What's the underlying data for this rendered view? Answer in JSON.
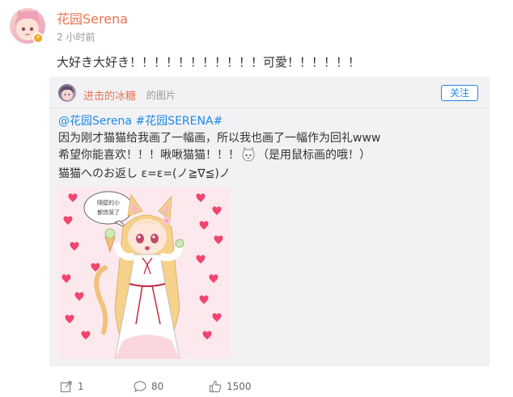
{
  "post": {
    "author_name": "花园Serena",
    "time": "2 小时前",
    "text": "大好き大好き！！！！！！！！！！！可愛！！！！！！"
  },
  "repost": {
    "author_name": "进击的冰糖",
    "author_suffix": "的图片",
    "follow_label": "关注",
    "mention": "@花园Serena",
    "hashtag": "#花园SERENA#",
    "line2": "因为刚才猫猫给我画了一幅画，所以我也画了一幅作为回礼www",
    "line3": "希望你能喜欢！！！啾啾猫猫！！！",
    "line3_emoji_name": "cat-face-emoji",
    "line3_end": "（是用鼠标画的哦！）",
    "line4": "猫猫へのお返し ε=ε=(ノ≧∇≦)ノ",
    "image_speech_text_1": "隔壁的小",
    "image_speech_text_2": "都馋哭了"
  },
  "actions": {
    "repost_count": "1",
    "comment_count": "80",
    "like_count": "1500"
  },
  "colors": {
    "author": "#eb7350",
    "link": "#1e88e5",
    "card_bg": "#f2f2f5",
    "heart": "#f0466e"
  }
}
